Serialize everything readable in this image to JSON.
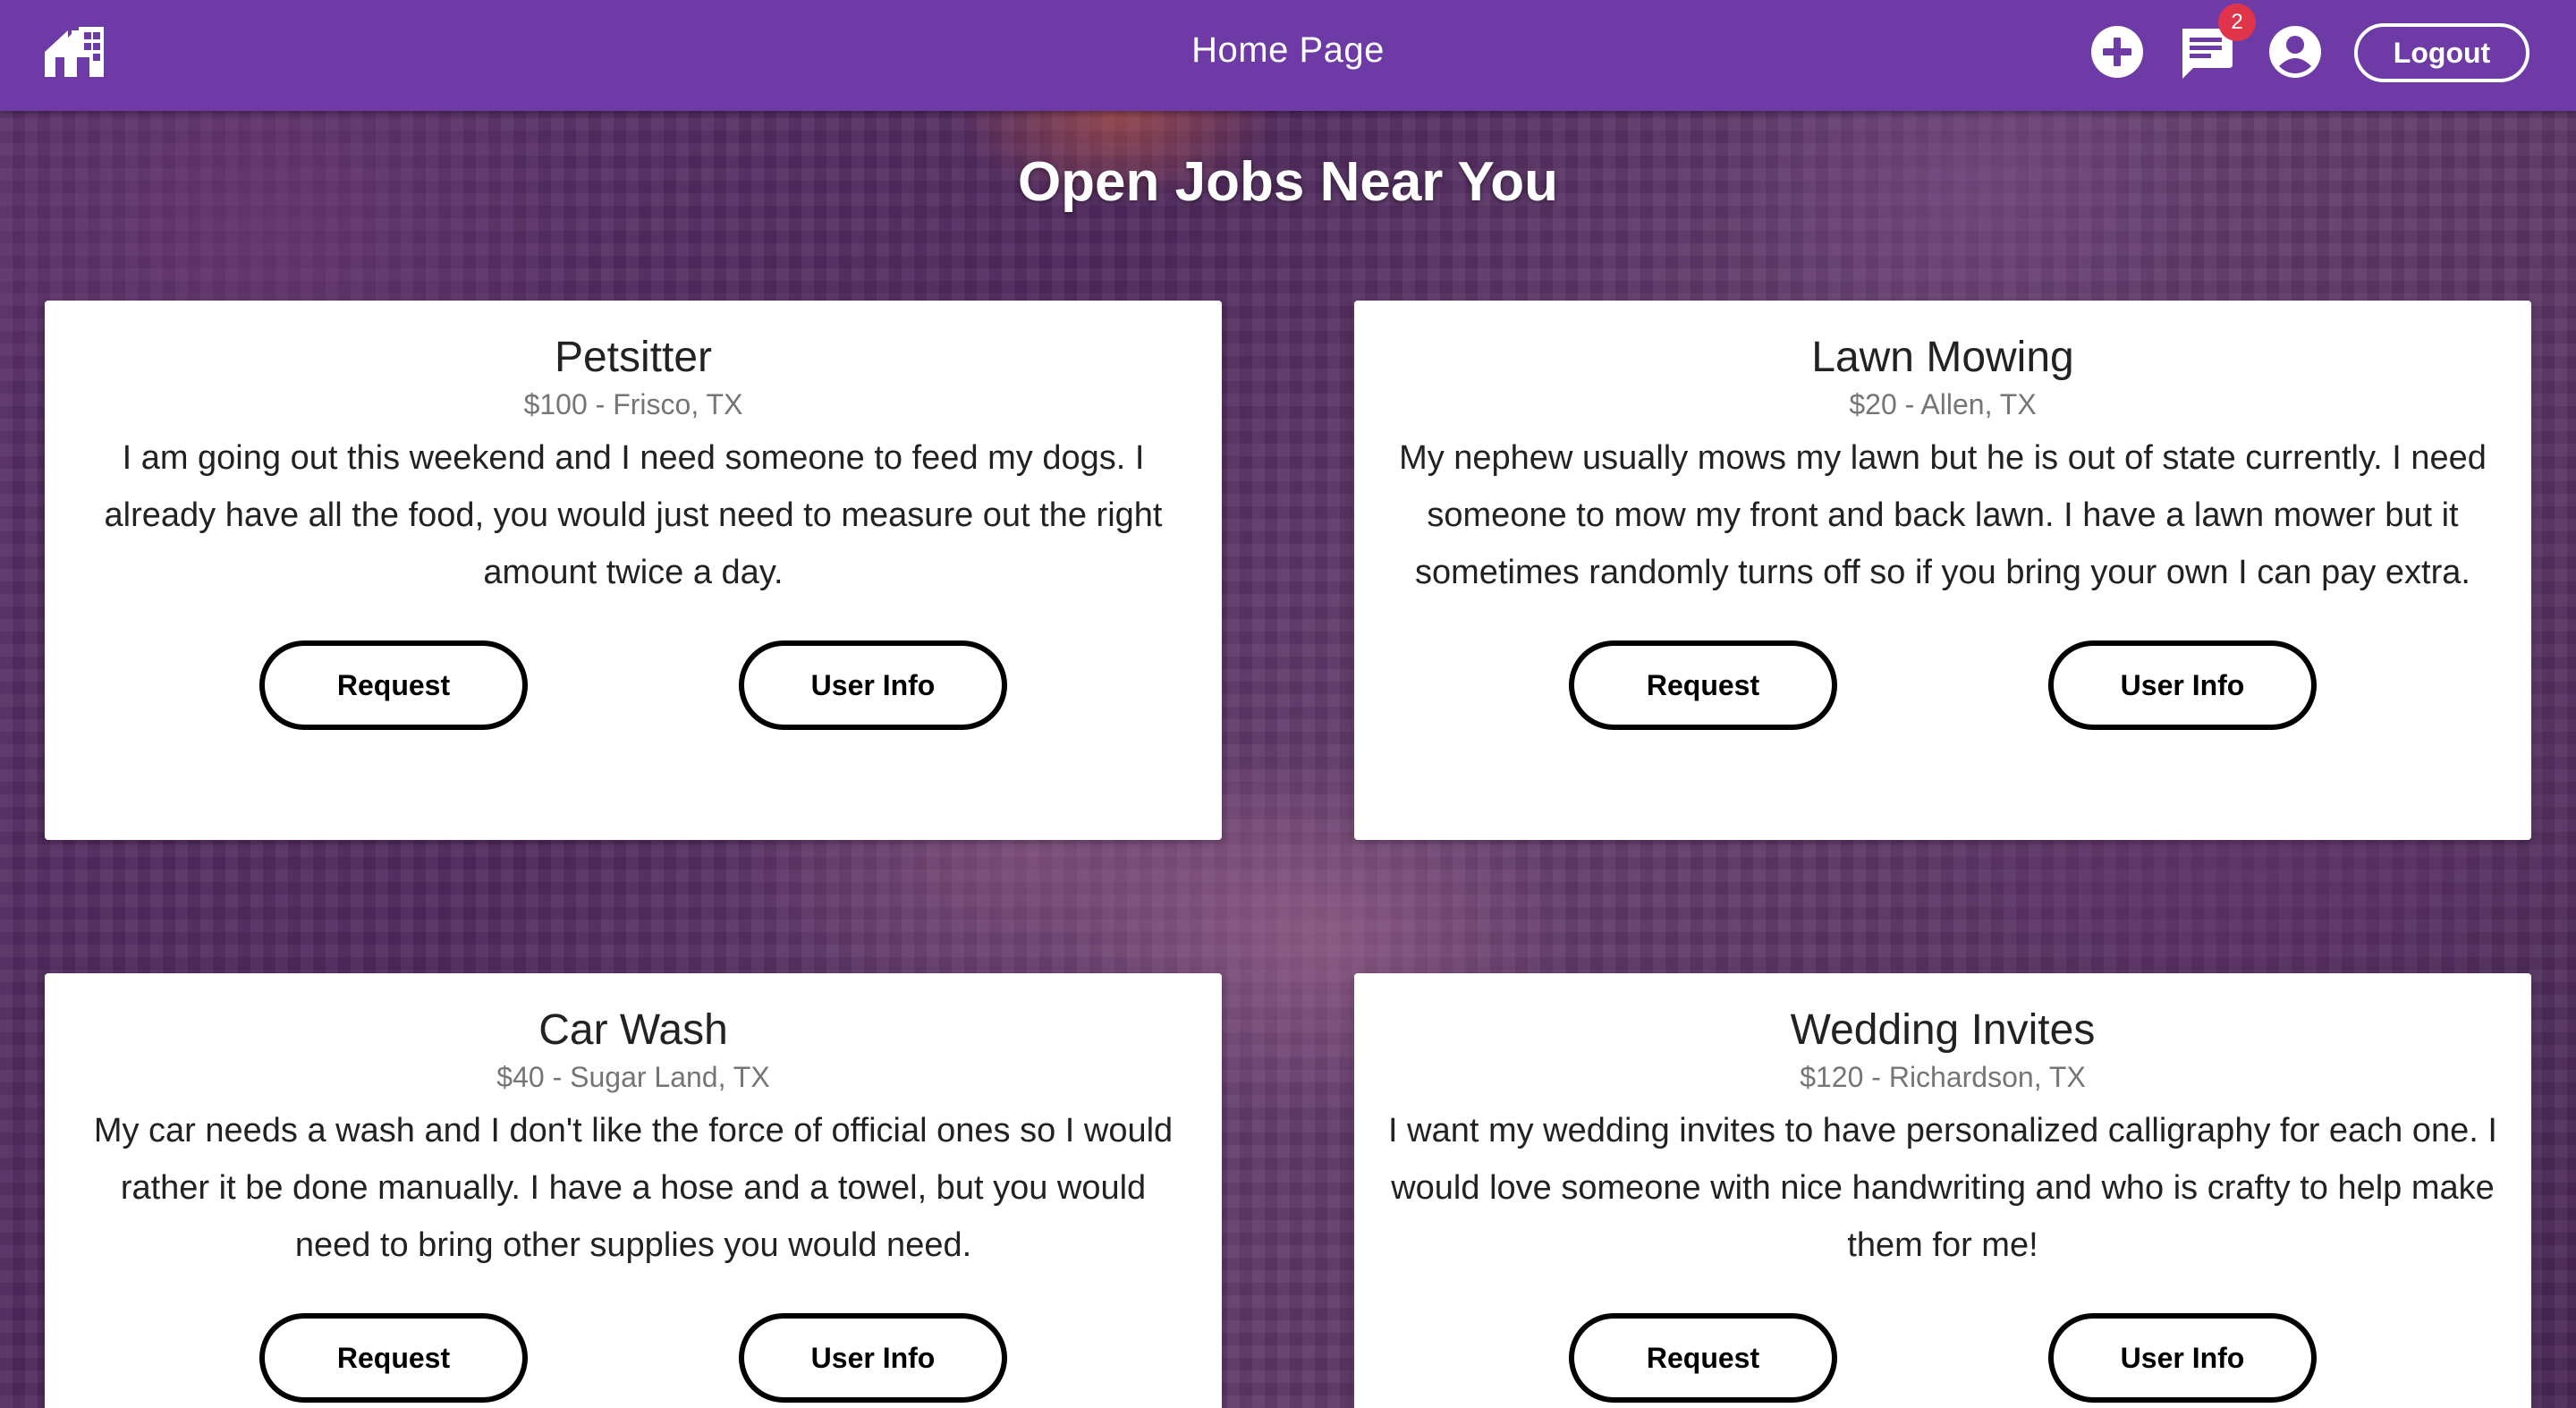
{
  "header": {
    "title": "Home Page",
    "notification_count": "2",
    "logout_label": "Logout",
    "icons": {
      "logo": "home-logo-icon",
      "add": "plus-circle-icon",
      "messages": "chat-icon",
      "account": "account-circle-icon"
    },
    "colors": {
      "bar": "#6e3aa6",
      "badge": "#e0344a"
    }
  },
  "main": {
    "heading": "Open Jobs Near You",
    "jobs": [
      {
        "title": "Petsitter",
        "meta": "$100 - Frisco, TX",
        "description": "I am going out this weekend and I need someone to feed my dogs. I already have all the food, you would just need to measure out the right amount twice a day.",
        "request_label": "Request",
        "user_info_label": "User Info"
      },
      {
        "title": "Lawn Mowing",
        "meta": "$20 - Allen, TX",
        "description": "My nephew usually mows my lawn but he is out of state currently. I need someone to mow my front and back lawn. I have a lawn mower but it sometimes randomly turns off so if you bring your own I can pay extra.",
        "request_label": "Request",
        "user_info_label": "User Info"
      },
      {
        "title": "Car Wash",
        "meta": "$40 - Sugar Land, TX",
        "description": "My car needs a wash and I don't like the force of official ones so I would rather it be done manually. I have a hose and a towel, but you would need to bring other supplies you would need.",
        "request_label": "Request",
        "user_info_label": "User Info"
      },
      {
        "title": "Wedding Invites",
        "meta": "$120 - Richardson, TX",
        "description": "I want my wedding invites to have personalized calligraphy for each one. I would love someone with nice handwriting and who is crafty to help make them for me!",
        "request_label": "Request",
        "user_info_label": "User Info"
      }
    ]
  }
}
